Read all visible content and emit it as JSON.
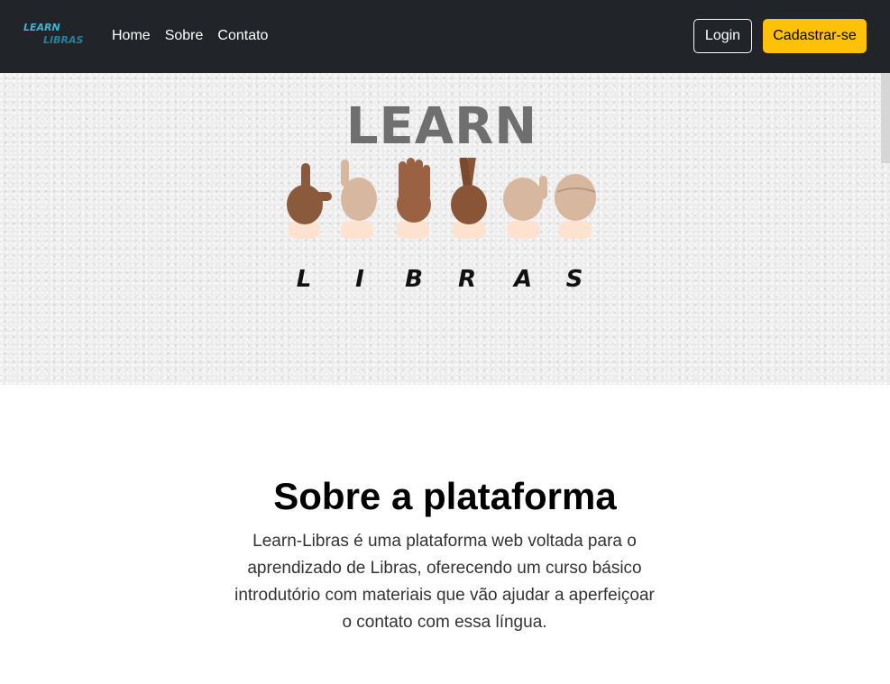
{
  "navbar": {
    "brand_top": "LEARN",
    "brand_bottom": "LIBRAS",
    "links": [
      "Home",
      "Sobre",
      "Contato"
    ],
    "login_label": "Login",
    "signup_label": "Cadastrar-se",
    "colors": {
      "background": "#212529",
      "signup": "#ffc107",
      "brand": "#3fb4d4"
    }
  },
  "hero": {
    "title": "LEARN",
    "letters": [
      "L",
      "I",
      "B",
      "R",
      "A",
      "S"
    ]
  },
  "about": {
    "title": "Sobre a plataforma",
    "text": "Learn-Libras é uma plataforma web voltada para o aprendizado de Libras, oferecendo um curso básico introdutório com materiais que vão ajudar a aperfeiçoar o contato com essa língua."
  }
}
